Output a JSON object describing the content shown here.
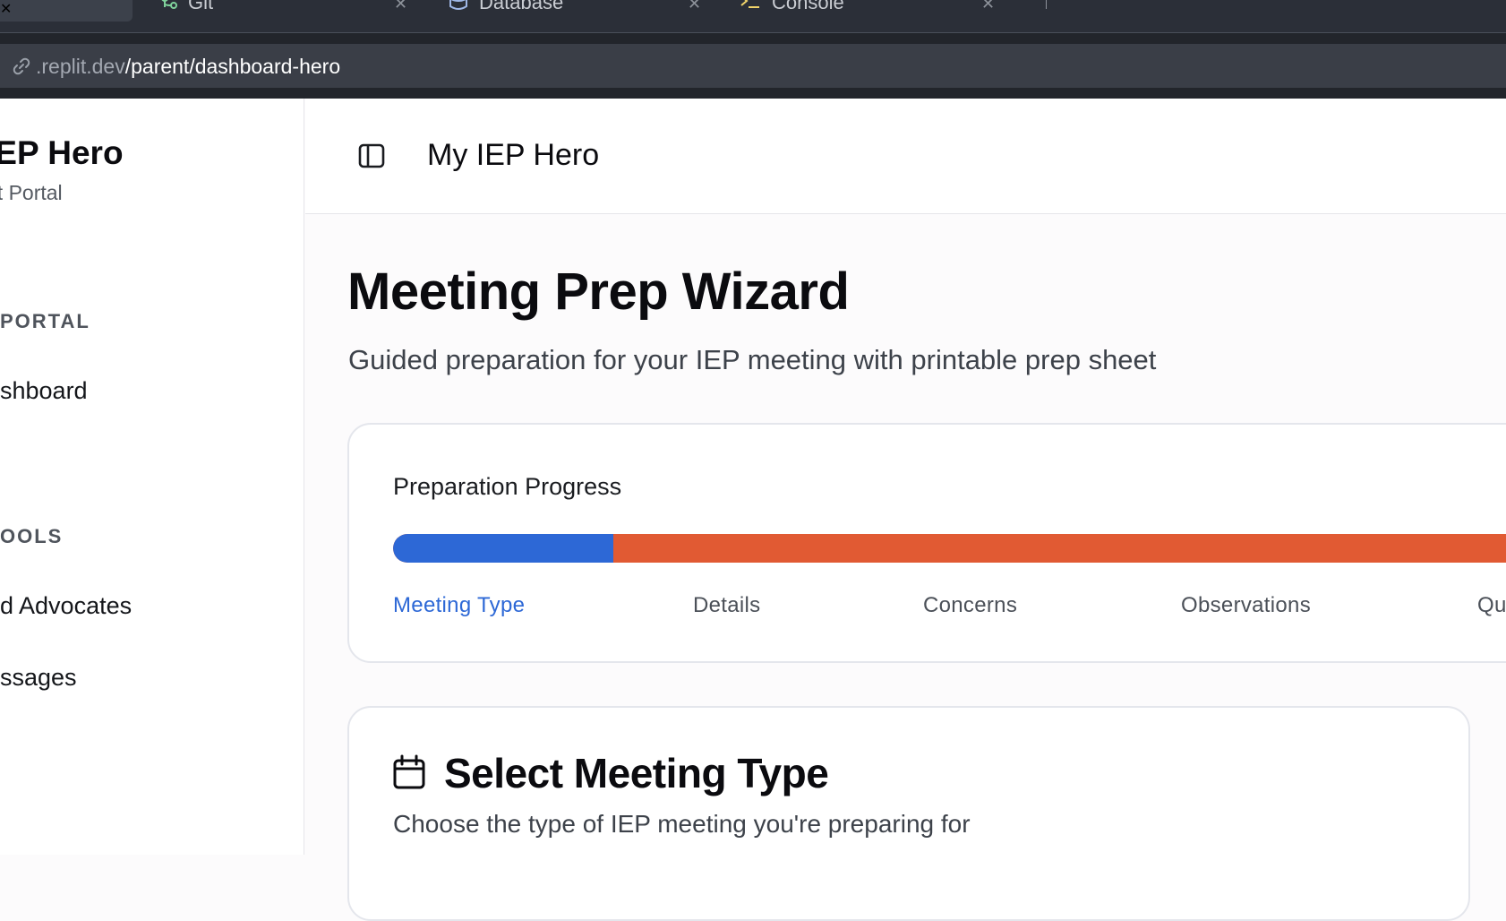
{
  "browser": {
    "tabs": [
      {
        "label": "",
        "icon": "close-icon"
      },
      {
        "label": "Git",
        "icon": "git-icon"
      },
      {
        "label": "Database",
        "icon": "database-icon"
      },
      {
        "label": "Console",
        "icon": "console-icon"
      }
    ],
    "url_host": ".replit.dev",
    "url_path": "/parent/dashboard-hero"
  },
  "sidebar": {
    "brand_title": "IEP Hero",
    "brand_sub": "nt Portal",
    "section_portal": "PORTAL",
    "nav_dashboard": "shboard",
    "section_tools": "OOLS",
    "nav_advocates": "d Advocates",
    "nav_messages": "ssages"
  },
  "header": {
    "toggle_icon": "sidebar-toggle-icon",
    "title": "My IEP Hero"
  },
  "main": {
    "title": "Meeting Prep Wizard",
    "subtitle": "Guided preparation for your IEP meeting with printable prep sheet",
    "progress": {
      "label": "Preparation Progress",
      "percent": 19.5,
      "fill_color": "#2d68d6",
      "track_color": "#e15a33",
      "steps": [
        "Meeting Type",
        "Details",
        "Concerns",
        "Observations",
        "Qu"
      ],
      "active_step": 0
    },
    "select_type": {
      "icon": "calendar-icon",
      "title": "Select Meeting Type",
      "subtitle": "Choose the type of IEP meeting you're preparing for"
    }
  }
}
